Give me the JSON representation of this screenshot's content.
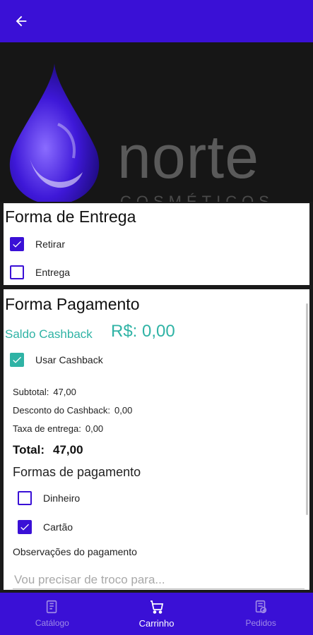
{
  "brand": {
    "name": "norte",
    "tagline": "COSMÉTICOS"
  },
  "entrega": {
    "title": "Forma de Entrega",
    "options": [
      {
        "label": "Retirar",
        "checked": true
      },
      {
        "label": "Entrega",
        "checked": false
      }
    ]
  },
  "pagamento": {
    "title": "Forma Pagamento",
    "saldo_label": "Saldo Cashback",
    "saldo_value": "R$: 0,00",
    "usar_cashback": {
      "label": "Usar Cashback",
      "checked": true
    },
    "subtotal": {
      "label": "Subtotal:",
      "value": "47,00"
    },
    "desconto": {
      "label": "Desconto do Cashback:",
      "value": "0,00"
    },
    "taxa": {
      "label": "Taxa de entrega:",
      "value": "0,00"
    },
    "total": {
      "label": "Total:",
      "value": "47,00"
    },
    "formas_title": "Formas de pagamento",
    "formas": [
      {
        "label": "Dinheiro",
        "checked": false
      },
      {
        "label": "Cartão",
        "checked": true
      }
    ],
    "obs_label": "Observações do pagamento",
    "obs_placeholder": "Vou precisar de troco para...",
    "obs_value": ""
  },
  "nav": {
    "items": [
      {
        "label": "Catálogo",
        "icon": "catalog-icon",
        "active": false
      },
      {
        "label": "Carrinho",
        "icon": "cart-icon",
        "active": true
      },
      {
        "label": "Pedidos",
        "icon": "orders-icon",
        "active": false
      }
    ]
  },
  "colors": {
    "primary": "#3a10d6",
    "accent": "#2fb3a5",
    "banner": "#161616"
  }
}
